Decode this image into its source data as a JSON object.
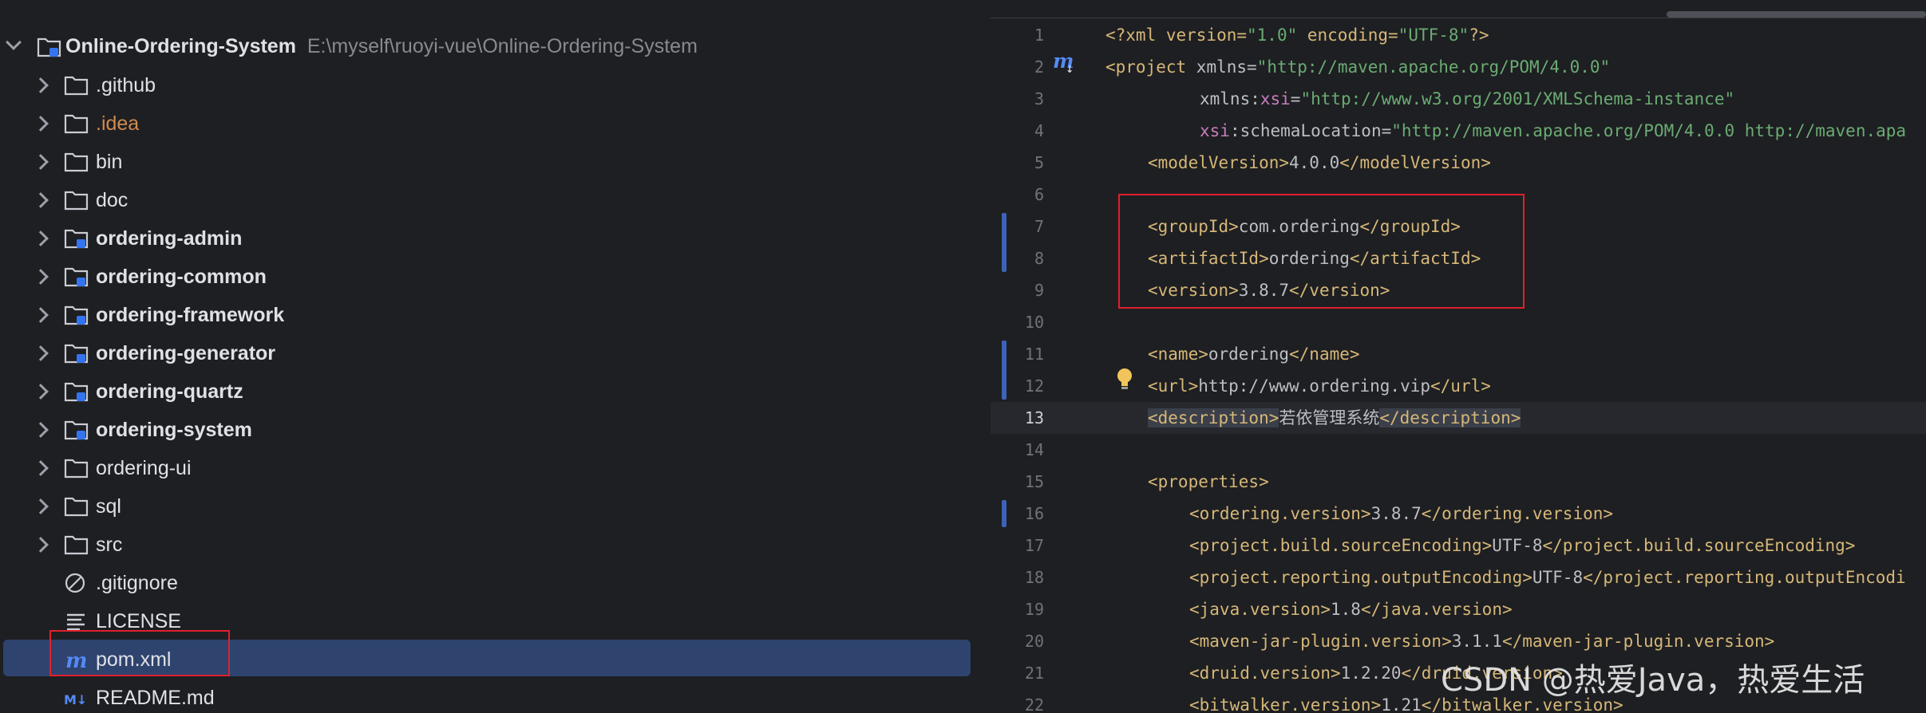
{
  "project_tree": {
    "root": {
      "name": "Online-Ordering-System",
      "path": "E:\\myself\\ruoyi-vue\\Online-Ordering-System"
    },
    "items": [
      {
        "label": ".github",
        "kind": "folder"
      },
      {
        "label": ".idea",
        "kind": "folder"
      },
      {
        "label": "bin",
        "kind": "folder"
      },
      {
        "label": "doc",
        "kind": "folder"
      },
      {
        "label": "ordering-admin",
        "kind": "module"
      },
      {
        "label": "ordering-common",
        "kind": "module"
      },
      {
        "label": "ordering-framework",
        "kind": "module"
      },
      {
        "label": "ordering-generator",
        "kind": "module"
      },
      {
        "label": "ordering-quartz",
        "kind": "module"
      },
      {
        "label": "ordering-system",
        "kind": "module"
      },
      {
        "label": "ordering-ui",
        "kind": "folder"
      },
      {
        "label": "sql",
        "kind": "folder"
      },
      {
        "label": "src",
        "kind": "folder"
      },
      {
        "label": ".gitignore",
        "kind": "ignore-file"
      },
      {
        "label": "LICENSE",
        "kind": "text-file"
      },
      {
        "label": "pom.xml",
        "kind": "maven-file",
        "selected": true
      },
      {
        "label": "README.md",
        "kind": "markdown-file"
      }
    ]
  },
  "editor": {
    "line_numbers": [
      "1",
      "2",
      "3",
      "4",
      "5",
      "6",
      "7",
      "8",
      "9",
      "10",
      "11",
      "12",
      "13",
      "14",
      "15",
      "16",
      "17",
      "18",
      "19",
      "20",
      "21",
      "22"
    ],
    "current_line": "13",
    "code": {
      "l1": {
        "decl": "<?xml version=",
        "v1": "\"1.0\"",
        "enc": " encoding=",
        "v2": "\"UTF-8\"",
        "end": "?>"
      },
      "l2": {
        "tag": "<project",
        "attr": " xmlns=",
        "val": "\"http://maven.apache.org/POM/4.0.0\""
      },
      "l3": {
        "attr": "xmlns:",
        "ns": "xsi",
        "eq": "=",
        "val": "\"http://www.w3.org/2001/XMLSchema-instance\""
      },
      "l4": {
        "ns": "xsi",
        "attr": ":schemaLocation=",
        "val": "\"http://maven.apache.org/POM/4.0.0 http://maven.apa"
      },
      "l5": {
        "open": "<modelVersion>",
        "text": "4.0.0",
        "close": "</modelVersion>"
      },
      "l7": {
        "open": "<groupId>",
        "text": "com.ordering",
        "close": "</groupId>"
      },
      "l8": {
        "open": "<artifactId>",
        "text": "ordering",
        "close": "</artifactId>"
      },
      "l9": {
        "open": "<version>",
        "text": "3.8.7",
        "close": "</version>"
      },
      "l11": {
        "open": "<name>",
        "text": "ordering",
        "close": "</name>"
      },
      "l12": {
        "open": "<url>",
        "text": "http://www.ordering.vip",
        "close": "</url>"
      },
      "l13": {
        "open": "<description>",
        "text": "若依管理系统",
        "close": "</description>"
      },
      "l15": {
        "open": "<properties>"
      },
      "l16": {
        "open": "<ordering.version>",
        "text": "3.8.7",
        "close": "</ordering.version>"
      },
      "l17": {
        "open": "<project.build.sourceEncoding>",
        "text": "UTF-8",
        "close": "</project.build.sourceEncoding>"
      },
      "l18": {
        "open": "<project.reporting.outputEncoding>",
        "text": "UTF-8",
        "close": "</project.reporting.outputEncodi"
      },
      "l19": {
        "open": "<java.version>",
        "text": "1.8",
        "close": "</java.version>"
      },
      "l20": {
        "open": "<maven-jar-plugin.version>",
        "text": "3.1.1",
        "close": "</maven-jar-plugin.version>"
      },
      "l21": {
        "open": "<druid.version>",
        "text": "1.2.20",
        "close": "</druid.version>"
      },
      "l22": {
        "open": "<bitwalker.version>",
        "text": "1.21",
        "close": "</bitwalker.version>"
      }
    }
  },
  "gutter": {
    "maven_icon": "m",
    "bulb_icon": "lightbulb-icon"
  },
  "watermark": "CSDN @热爱Java，热爱生活",
  "colors": {
    "selection": "#2e436e",
    "highlight_box": "#e0202e",
    "modified_bar": "#3d63b8"
  }
}
